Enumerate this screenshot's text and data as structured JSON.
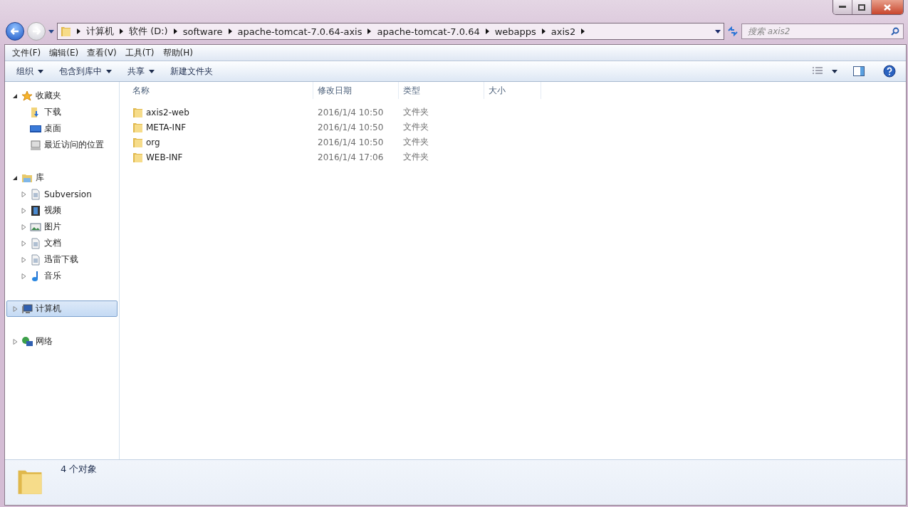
{
  "address_bar": {
    "segments": [
      "计算机",
      "软件 (D:)",
      "software",
      "apache-tomcat-7.0.64-axis",
      "apache-tomcat-7.0.64",
      "webapps",
      "axis2"
    ]
  },
  "search": {
    "placeholder": "搜索 axis2"
  },
  "menu_bar": [
    "文件(F)",
    "编辑(E)",
    "查看(V)",
    "工具(T)",
    "帮助(H)"
  ],
  "toolbar": [
    {
      "label": "组织",
      "dropdown": true
    },
    {
      "label": "包含到库中",
      "dropdown": true
    },
    {
      "label": "共享",
      "dropdown": true
    },
    {
      "label": "新建文件夹",
      "dropdown": false
    }
  ],
  "sidebar": {
    "items": [
      {
        "label": "收藏夹",
        "kind": "star",
        "expanded": true,
        "selected": false,
        "children": [
          {
            "label": "下载",
            "kind": "download",
            "selected": false
          },
          {
            "label": "桌面",
            "kind": "desktop",
            "selected": false
          },
          {
            "label": "最近访问的位置",
            "kind": "recent",
            "selected": false
          }
        ]
      },
      {
        "label": "库",
        "kind": "library",
        "expanded": true,
        "selected": false,
        "children": [
          {
            "label": "Subversion",
            "kind": "document",
            "expanded": false,
            "selected": false
          },
          {
            "label": "视频",
            "kind": "video",
            "expanded": false,
            "selected": false
          },
          {
            "label": "图片",
            "kind": "picture",
            "expanded": false,
            "selected": false
          },
          {
            "label": "文档",
            "kind": "document",
            "expanded": false,
            "selected": false
          },
          {
            "label": "迅雷下载",
            "kind": "document",
            "expanded": false,
            "selected": false
          },
          {
            "label": "音乐",
            "kind": "music",
            "expanded": false,
            "selected": false
          }
        ]
      },
      {
        "label": "计算机",
        "kind": "computer",
        "expanded": false,
        "selected": true
      },
      {
        "label": "网络",
        "kind": "network",
        "expanded": false,
        "selected": false
      }
    ]
  },
  "table": {
    "columns": [
      "名称",
      "修改日期",
      "类型",
      "大小"
    ],
    "rows": [
      {
        "name": "axis2-web",
        "modified": "2016/1/4 10:50",
        "type": "文件夹"
      },
      {
        "name": "META-INF",
        "modified": "2016/1/4 10:50",
        "type": "文件夹"
      },
      {
        "name": "org",
        "modified": "2016/1/4 10:50",
        "type": "文件夹"
      },
      {
        "name": "WEB-INF",
        "modified": "2016/1/4 17:06",
        "type": "文件夹"
      }
    ]
  },
  "status_bar": {
    "text": "4 个对象"
  }
}
